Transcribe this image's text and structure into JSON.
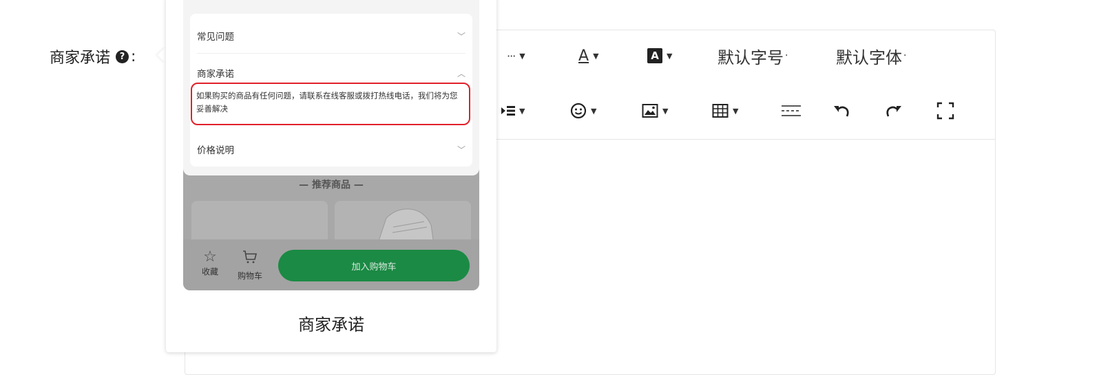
{
  "form": {
    "label": "商家承诺",
    "colon": ":",
    "help_icon": "question-circle-icon"
  },
  "editor": {
    "toolbar_row1": {
      "more": "···",
      "font_color": "A",
      "bg_color": "A",
      "font_size": "默认字号",
      "font_family": "默认字体"
    },
    "toolbar_row2": {
      "indent_icon": "indent-icon",
      "emoji_icon": "emoji-icon",
      "image_icon": "image-icon",
      "table_icon": "table-icon",
      "divider_icon": "horizontal-rule-icon",
      "undo_icon": "undo-icon",
      "redo_icon": "redo-icon",
      "fullscreen_icon": "fullscreen-icon"
    }
  },
  "preview": {
    "accordion": [
      {
        "title": "常见问题",
        "state": "collapsed"
      },
      {
        "title": "商家承诺",
        "state": "expanded",
        "body": "如果购买的商品有任何问题，请联系在线客服或拨打热线电话，我们将为您妥善解决"
      },
      {
        "title": "价格说明",
        "state": "collapsed"
      }
    ],
    "recommend_title": "推荐商品",
    "bottom_bar": {
      "favorite": "收藏",
      "cart": "购物车",
      "add_to_cart": "加入购物车"
    },
    "caption": "商家承诺",
    "colors": {
      "highlight_border": "#e0202a",
      "primary_button": "#1b8a44"
    }
  }
}
